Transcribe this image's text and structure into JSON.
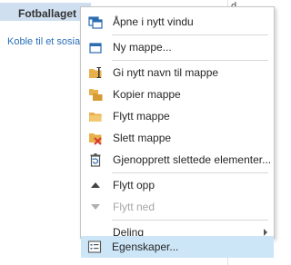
{
  "background": {
    "folder_name": "Fotballaget",
    "link_text": "Koble til et sosia",
    "right_pane_char": "d"
  },
  "menu": {
    "items": [
      {
        "label": "Åpne i nytt vindu",
        "icon": "open-window-icon",
        "enabled": true
      },
      {
        "label": "Ny mappe...",
        "icon": "new-folder-icon",
        "enabled": true
      },
      {
        "label": "Gi nytt navn til mappe",
        "icon": "rename-folder-icon",
        "enabled": true
      },
      {
        "label": "Kopier mappe",
        "icon": "copy-folder-icon",
        "enabled": true
      },
      {
        "label": "Flytt mappe",
        "icon": "move-folder-icon",
        "enabled": true
      },
      {
        "label": "Slett mappe",
        "icon": "delete-folder-icon",
        "enabled": true
      },
      {
        "label": "Gjenopprett slettede elementer...",
        "icon": "recover-deleted-icon",
        "enabled": true
      },
      {
        "label": "Flytt opp",
        "icon": "move-up-icon",
        "enabled": true
      },
      {
        "label": "Flytt ned",
        "icon": "move-down-icon",
        "enabled": false
      },
      {
        "label": "Deling",
        "icon": "",
        "enabled": true,
        "has_submenu": true
      },
      {
        "label": "Egenskaper...",
        "icon": "properties-icon",
        "enabled": true,
        "highlighted": true
      }
    ]
  },
  "colors": {
    "highlight": "#cde6f7",
    "folder_yellow": "#e8b04b",
    "accent_blue": "#2b6cb0",
    "delete_red": "#d9352a"
  }
}
